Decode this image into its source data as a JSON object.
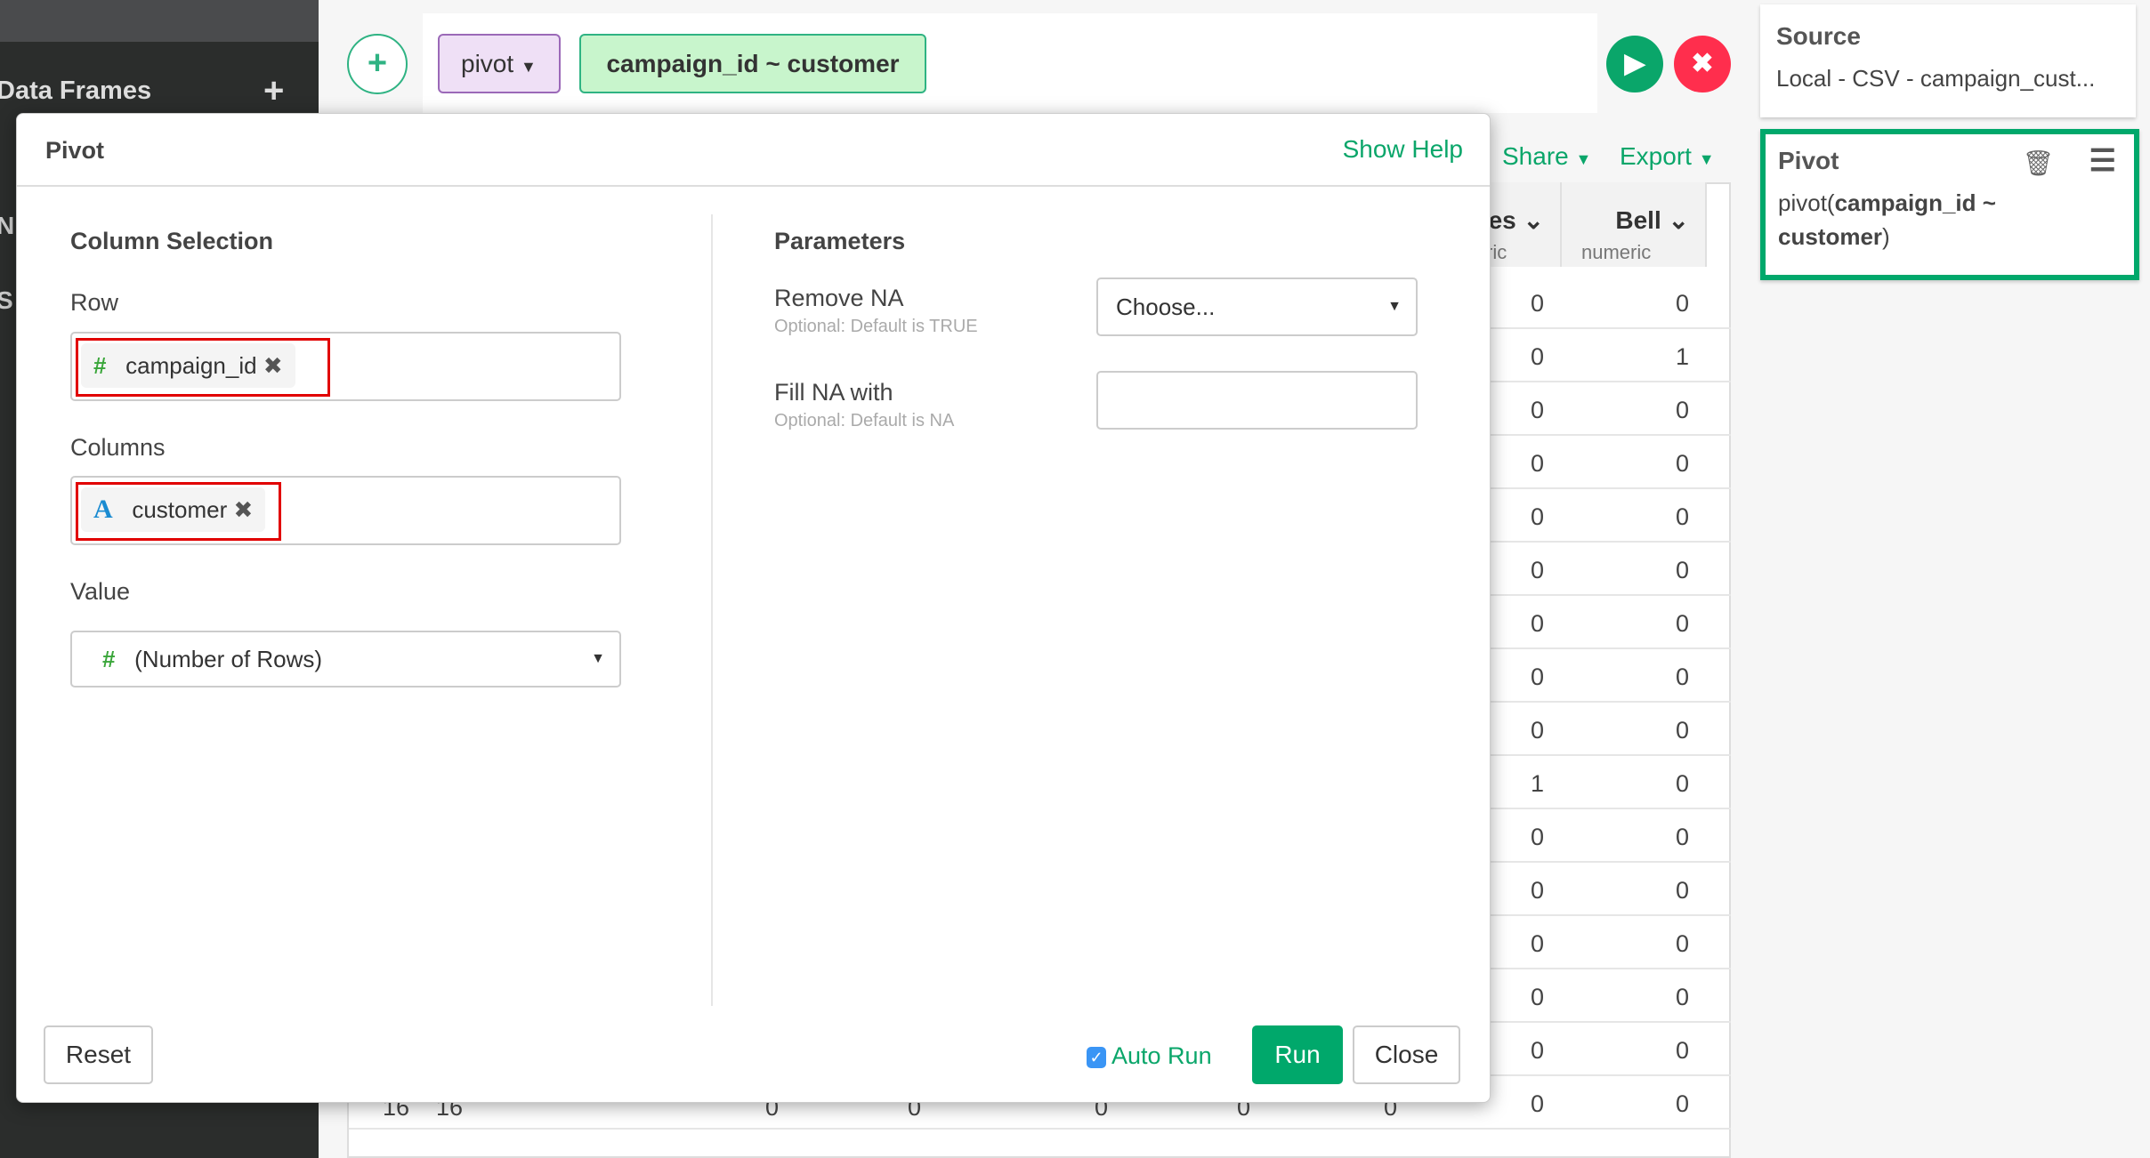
{
  "sidebar": {
    "title": "Data Frames",
    "frag1": "N",
    "frag2": "S"
  },
  "toolbar": {
    "command": "pivot",
    "formula": "campaign_id ~ customer"
  },
  "right": {
    "source_title": "Source",
    "source_text": "Local - CSV - campaign_cust...",
    "step_title": "Pivot",
    "step_fn": "pivot(",
    "step_arg1": "campaign_id ~",
    "step_arg2": "customer",
    ")": ")",
    "close_paren": ")"
  },
  "actions": {
    "share": "Share",
    "export": "Export"
  },
  "table": {
    "col1": {
      "name": "es",
      "type": "ric"
    },
    "col2": {
      "name": "Bell",
      "type": "numeric"
    },
    "col1_values": [
      "0",
      "0",
      "0",
      "0",
      "0",
      "0",
      "0",
      "0",
      "0",
      "1",
      "0",
      "0",
      "0",
      "0",
      "0",
      "0"
    ],
    "col2_values": [
      "0",
      "1",
      "0",
      "0",
      "0",
      "0",
      "0",
      "0",
      "0",
      "0",
      "0",
      "0",
      "0",
      "0",
      "0",
      "0"
    ],
    "last_row": [
      "16",
      "16",
      "0",
      "0",
      "0",
      "0",
      "0"
    ]
  },
  "dialog": {
    "title": "Pivot",
    "show_help": "Show Help",
    "column_selection": "Column Selection",
    "row_label": "Row",
    "row_chip": "campaign_id",
    "columns_label": "Columns",
    "columns_chip": "customer",
    "value_label": "Value",
    "value_selected": "(Number of Rows)",
    "parameters": "Parameters",
    "remove_na": "Remove NA",
    "remove_na_hint": "Optional: Default is TRUE",
    "remove_na_value": "Choose...",
    "fill_na": "Fill NA with",
    "fill_na_hint": "Optional: Default is NA",
    "fill_na_value": "",
    "reset": "Reset",
    "auto_run": "Auto Run",
    "auto_run_checked": true,
    "run": "Run",
    "close": "Close"
  },
  "colors": {
    "accent": "#0aa66a",
    "danger": "#ff2e4d",
    "highlight": "#e10000",
    "pivot_tag": "#efe0f6",
    "formula_tag": "#c8f5cc"
  }
}
